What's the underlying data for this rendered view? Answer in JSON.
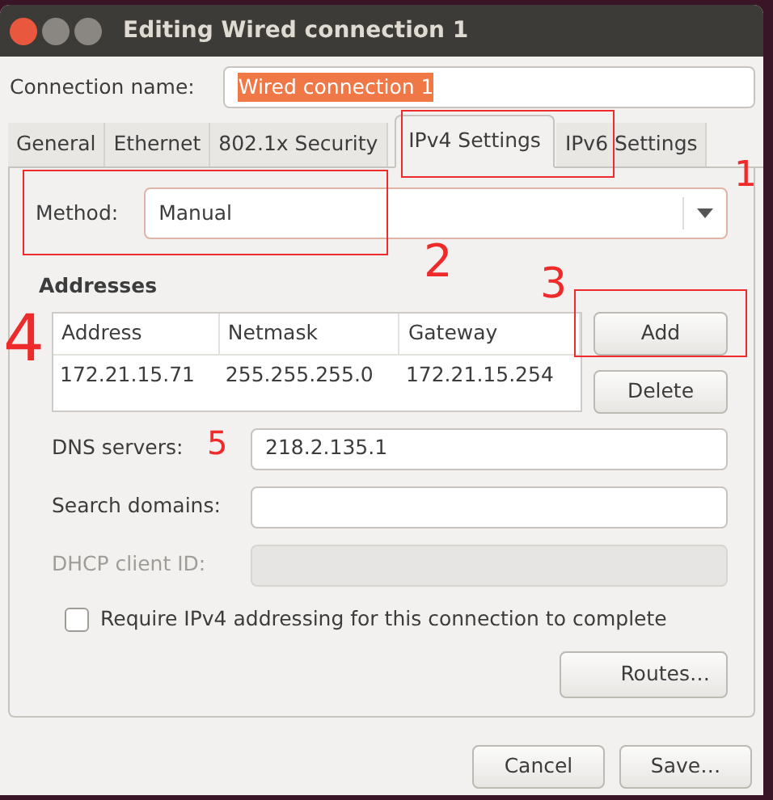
{
  "window": {
    "title": "Editing Wired connection 1"
  },
  "connection_name": {
    "label": "Connection name:",
    "value": "Wired connection 1",
    "text_selected": true
  },
  "tabs": [
    {
      "label": "General",
      "selected": false
    },
    {
      "label": "Ethernet",
      "selected": false
    },
    {
      "label": "802.1x Security",
      "selected": false
    },
    {
      "label": "IPv4 Settings",
      "selected": true
    },
    {
      "label": "IPv6 Settings",
      "selected": false
    }
  ],
  "method": {
    "label": "Method:",
    "value": "Manual"
  },
  "addresses": {
    "heading": "Addresses",
    "columns": [
      "Address",
      "Netmask",
      "Gateway"
    ],
    "rows": [
      [
        "172.21.15.71",
        "255.255.255.0",
        "172.21.15.254"
      ]
    ],
    "buttons": [
      {
        "label": "Add",
        "disabled": false
      },
      {
        "label": "Delete",
        "disabled": false
      }
    ]
  },
  "fields": [
    {
      "label": "DNS servers:",
      "value": "218.2.135.1",
      "disabled": false
    },
    {
      "label": "Search domains:",
      "disabled": false
    },
    {
      "label": "DHCP client ID:",
      "disabled": true
    }
  ],
  "require_ipv4": {
    "label": "Require IPv4 addressing for this connection to complete",
    "checked": false
  },
  "routes_button": "Routes…",
  "dialog_buttons": [
    "Cancel",
    "Save…"
  ],
  "annotations": [
    {
      "kind": "box"
    },
    {
      "kind": "box"
    },
    {
      "kind": "box"
    },
    {
      "kind": "number",
      "label": "1"
    },
    {
      "kind": "number",
      "label": "2"
    },
    {
      "kind": "number",
      "label": "3"
    },
    {
      "kind": "number",
      "label": "4"
    },
    {
      "kind": "number",
      "label": "5"
    }
  ]
}
